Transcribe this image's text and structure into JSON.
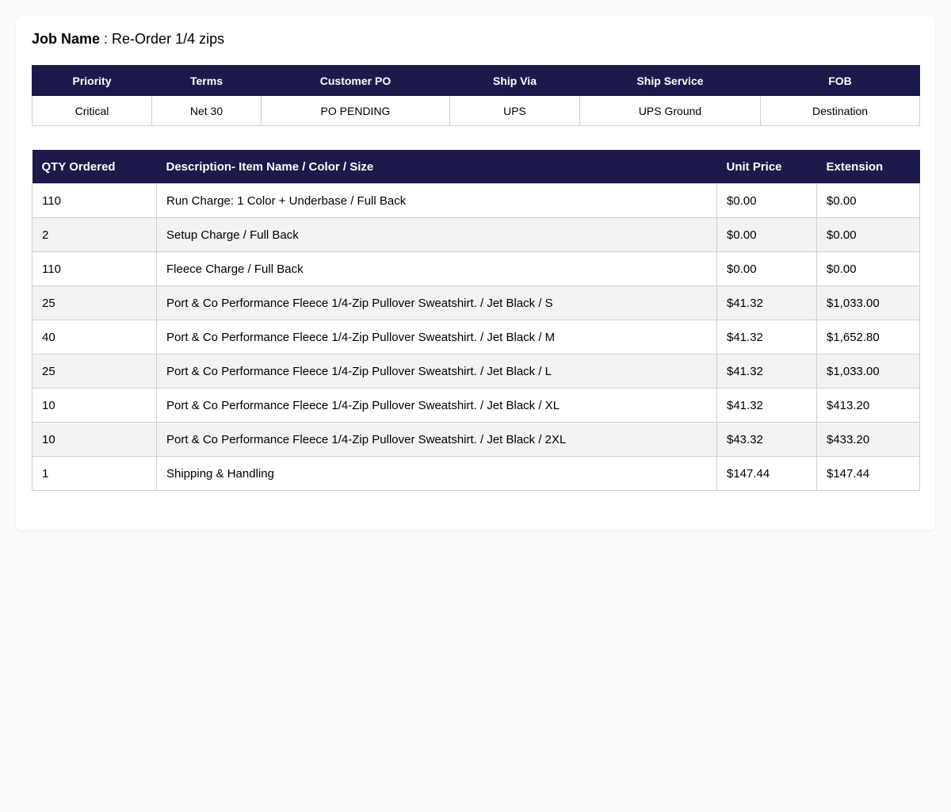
{
  "job": {
    "label": "Job Name",
    "separator": " : ",
    "name": "Re-Order 1/4 zips"
  },
  "info": {
    "headers": [
      "Priority",
      "Terms",
      "Customer PO",
      "Ship Via",
      "Ship Service",
      "FOB"
    ],
    "values": [
      "Critical",
      "Net 30",
      "PO PENDING",
      "UPS",
      "UPS Ground",
      "Destination"
    ]
  },
  "items": {
    "headers": [
      "QTY Ordered",
      "Description- Item Name / Color / Size",
      "Unit Price",
      "Extension"
    ],
    "rows": [
      {
        "qty": "110",
        "description": "Run Charge: 1 Color + Underbase / Full Back",
        "unit_price": "$0.00",
        "extension": "$0.00"
      },
      {
        "qty": "2",
        "description": "Setup Charge / Full Back",
        "unit_price": "$0.00",
        "extension": "$0.00"
      },
      {
        "qty": "110",
        "description": "Fleece Charge / Full Back",
        "unit_price": "$0.00",
        "extension": "$0.00"
      },
      {
        "qty": "25",
        "description": "Port & Co Performance Fleece 1/4-Zip Pullover Sweatshirt. / Jet Black / S",
        "unit_price": "$41.32",
        "extension": "$1,033.00"
      },
      {
        "qty": "40",
        "description": "Port & Co Performance Fleece 1/4-Zip Pullover Sweatshirt. / Jet Black / M",
        "unit_price": "$41.32",
        "extension": "$1,652.80"
      },
      {
        "qty": "25",
        "description": "Port & Co Performance Fleece 1/4-Zip Pullover Sweatshirt. / Jet Black / L",
        "unit_price": "$41.32",
        "extension": "$1,033.00"
      },
      {
        "qty": "10",
        "description": "Port & Co Performance Fleece 1/4-Zip Pullover Sweatshirt. / Jet Black / XL",
        "unit_price": "$41.32",
        "extension": "$413.20"
      },
      {
        "qty": "10",
        "description": "Port & Co Performance Fleece 1/4-Zip Pullover Sweatshirt. / Jet Black / 2XL",
        "unit_price": "$43.32",
        "extension": "$433.20"
      },
      {
        "qty": "1",
        "description": "Shipping & Handling",
        "unit_price": "$147.44",
        "extension": "$147.44"
      }
    ]
  },
  "colors": {
    "header_bg": "#1b1a4b",
    "page_bg": "#f9f9f9",
    "row_alt_bg": "#f3f3f3"
  }
}
